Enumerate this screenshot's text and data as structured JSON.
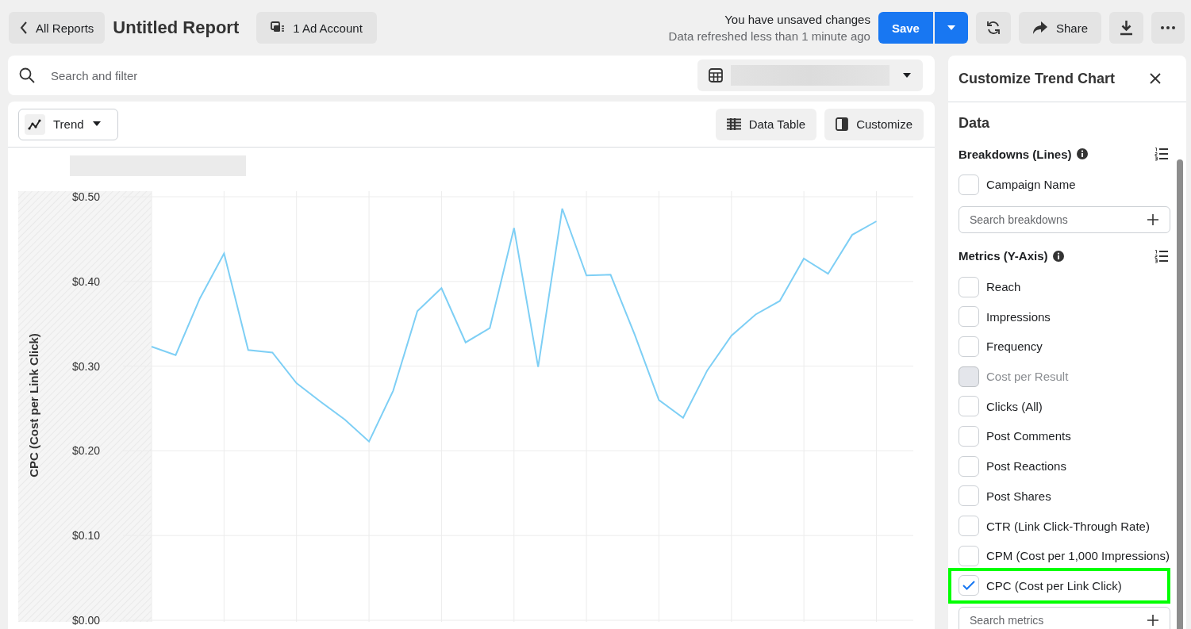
{
  "header": {
    "back_button": "All Reports",
    "title": "Untitled Report",
    "account_button": "1 Ad Account",
    "status": "You have unsaved changes",
    "refresh_note": "Data refreshed less than 1 minute ago",
    "save_button": "Save",
    "share_button": "Share"
  },
  "search": {
    "placeholder": "Search and filter"
  },
  "toolbar": {
    "view_dropdown": "Trend",
    "data_table_button": "Data Table",
    "customize_button": "Customize"
  },
  "chart": {
    "chart_data": {
      "type": "line",
      "grid": true,
      "ylabel": "CPC (Cost per Link Click)",
      "ylim": [
        0,
        0.5
      ],
      "yticks": [
        {
          "value": 0,
          "label": "$0.00"
        },
        {
          "value": 0.1,
          "label": "$0.10"
        },
        {
          "value": 0.2,
          "label": "$0.20"
        },
        {
          "value": 0.3,
          "label": "$0.30"
        },
        {
          "value": 0.4,
          "label": "$0.40"
        },
        {
          "value": 0.5,
          "label": "$0.50"
        }
      ],
      "series": [
        {
          "color": "#7ecff5",
          "values": [
            0.323,
            0.313,
            0.38,
            0.433,
            0.319,
            0.316,
            0.28,
            0.258,
            0.237,
            0.211,
            0.271,
            0.365,
            0.392,
            0.328,
            0.345,
            0.463,
            0.299,
            0.486,
            0.407,
            0.408,
            0.337,
            0.26,
            0.239,
            0.295,
            0.336,
            0.361,
            0.377,
            0.427,
            0.409,
            0.455,
            0.471
          ]
        }
      ]
    }
  },
  "customize_panel": {
    "title": "Customize Trend Chart",
    "section": "Data",
    "breakdowns": {
      "heading": "Breakdowns (Lines)",
      "items": [
        {
          "label": "Campaign Name",
          "checked": false,
          "disabled": false,
          "highlighted": false
        }
      ],
      "search_placeholder": "Search breakdowns"
    },
    "metrics": {
      "heading": "Metrics (Y-Axis)",
      "items": [
        {
          "label": "Reach",
          "checked": false,
          "disabled": false,
          "highlighted": false
        },
        {
          "label": "Impressions",
          "checked": false,
          "disabled": false,
          "highlighted": false
        },
        {
          "label": "Frequency",
          "checked": false,
          "disabled": false,
          "highlighted": false
        },
        {
          "label": "Cost per Result",
          "checked": false,
          "disabled": true,
          "highlighted": false
        },
        {
          "label": "Clicks (All)",
          "checked": false,
          "disabled": false,
          "highlighted": false
        },
        {
          "label": "Post Comments",
          "checked": false,
          "disabled": false,
          "highlighted": false
        },
        {
          "label": "Post Reactions",
          "checked": false,
          "disabled": false,
          "highlighted": false
        },
        {
          "label": "Post Shares",
          "checked": false,
          "disabled": false,
          "highlighted": false
        },
        {
          "label": "CTR (Link Click-Through Rate)",
          "checked": false,
          "disabled": false,
          "highlighted": false
        },
        {
          "label": "CPM (Cost per 1,000 Impressions)",
          "checked": false,
          "disabled": false,
          "highlighted": false
        },
        {
          "label": "CPC (Cost per Link Click)",
          "checked": true,
          "disabled": false,
          "highlighted": true
        }
      ],
      "search_placeholder": "Search metrics"
    }
  }
}
